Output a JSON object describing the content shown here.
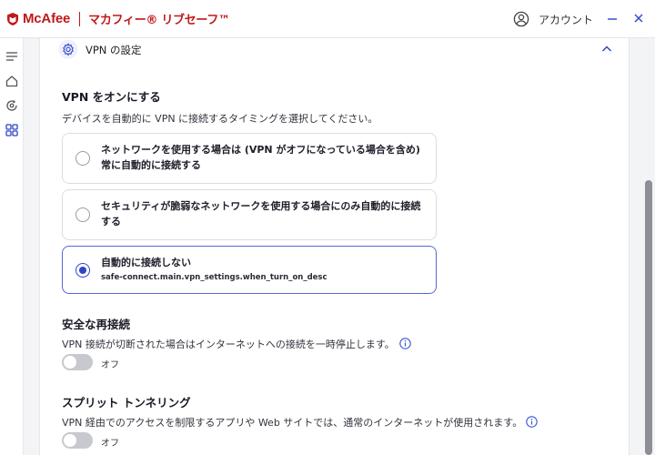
{
  "app": {
    "brand": "McAfee",
    "product": "マカフィー® リブセーフ™",
    "brand_color": "#c01818"
  },
  "header": {
    "account_label": "アカウント",
    "account_icon": "user-circle-icon",
    "minimize_icon": "minimize-icon",
    "close_icon": "close-icon"
  },
  "rail": {
    "items": [
      {
        "icon": "menu-lines-icon"
      },
      {
        "icon": "home-icon"
      },
      {
        "icon": "refresh-shield-icon"
      },
      {
        "icon": "apps-grid-icon"
      }
    ]
  },
  "section": {
    "title": "VPN の設定",
    "icon": "gear-icon",
    "expanded": true
  },
  "vpn_on": {
    "heading": "VPN をオンにする",
    "description": "デバイスを自動的に VPN に接続するタイミングを選択してください。",
    "options": [
      {
        "label_line1": "ネットワークを使用する場合は (VPN がオフになっている場合を含め)",
        "label_line2": "常に自動的に接続する",
        "selected": false
      },
      {
        "label_line1": "セキュリティが脆弱なネットワークを使用する場合にのみ自動的に接続",
        "label_line2": "する",
        "selected": false
      },
      {
        "label_line1": "自動的に接続しない",
        "sub": "safe-connect.main.vpn_settings.when_turn_on_desc",
        "selected": true
      }
    ]
  },
  "safe_reconnect": {
    "heading": "安全な再接続",
    "description": "VPN 接続が切断された場合はインターネットへの接続を一時停止します。",
    "toggle_label": "オフ",
    "enabled": false
  },
  "split_tunneling": {
    "heading": "スプリット トンネリング",
    "description": "VPN 経由でのアクセスを制限するアプリや Web サイトでは、通常のインターネットが使用されます。",
    "toggle_label": "オフ",
    "enabled": false
  },
  "colors": {
    "accent": "#2f45c8",
    "selected_border": "#5468d8",
    "info": "#3a56d8"
  }
}
